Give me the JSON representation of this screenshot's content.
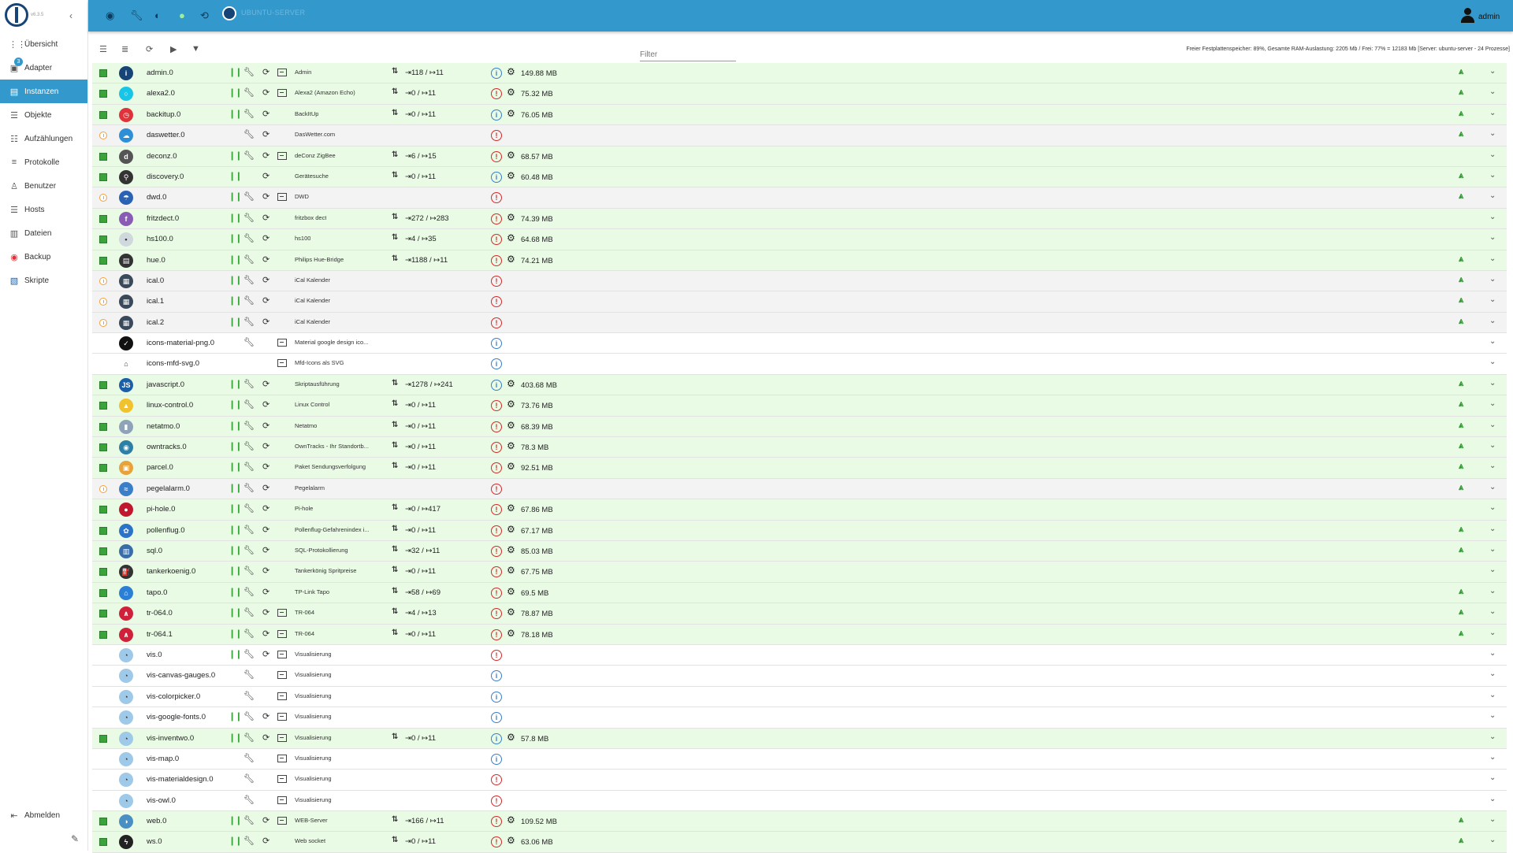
{
  "sidebar": {
    "version": "v6.3.5",
    "items": [
      {
        "label": "Übersicht",
        "icon": "grid-icon",
        "active": false
      },
      {
        "label": "Adapter",
        "icon": "adapter-icon",
        "badge": "3",
        "active": false
      },
      {
        "label": "Instanzen",
        "icon": "instances-icon",
        "active": true
      },
      {
        "label": "Objekte",
        "icon": "objects-icon",
        "active": false
      },
      {
        "label": "Aufzählungen",
        "icon": "enums-icon",
        "active": false
      },
      {
        "label": "Protokolle",
        "icon": "logs-icon",
        "active": false
      },
      {
        "label": "Benutzer",
        "icon": "user-icon",
        "active": false
      },
      {
        "label": "Hosts",
        "icon": "hosts-icon",
        "active": false
      },
      {
        "label": "Dateien",
        "icon": "files-icon",
        "active": false
      },
      {
        "label": "Backup",
        "icon": "backup-icon",
        "active": false
      },
      {
        "label": "Skripte",
        "icon": "scripts-icon",
        "active": false
      }
    ],
    "logout": "Abmelden"
  },
  "header": {
    "host": "UBUNTU-SERVER",
    "user": "admin"
  },
  "toolbar": {
    "filter_placeholder": "Filter",
    "sysinfo": "Freier Festplattenspeicher: 89%, Gesamte RAM-Auslastung: 2205 Mb / Frei: 77% = 12183 Mb [Server: ubuntu-server - 24 Prozesse]"
  },
  "colors": {
    "accent": "#3399cc",
    "running": "#e9fbe5",
    "stopped": "#f3f3f3",
    "ok_green": "#3ba33b"
  },
  "instances": [
    {
      "name": "admin.0",
      "title": "Admin",
      "status": "on",
      "icon_color": "#164477",
      "icon_text": "i",
      "pause": true,
      "wrench": true,
      "reload": true,
      "link": true,
      "events": "⇥118 / ↦11",
      "info": "blue",
      "mem": "149.88 MB",
      "signal": true
    },
    {
      "name": "alexa2.0",
      "title": "Alexa2 (Amazon Echo)",
      "status": "on",
      "icon_color": "#19c5e6",
      "icon_text": "○",
      "pause": true,
      "wrench": true,
      "reload": true,
      "link": true,
      "events": "⇥0 / ↦11",
      "info": "red",
      "mem": "75.32 MB",
      "signal": true
    },
    {
      "name": "backitup.0",
      "title": "BackItUp",
      "status": "on",
      "icon_color": "#e0323a",
      "icon_text": "◷",
      "pause": true,
      "wrench": true,
      "reload": true,
      "link": false,
      "events": "⇥0 / ↦11",
      "info": "blue",
      "mem": "76.05 MB",
      "signal": true
    },
    {
      "name": "daswetter.0",
      "title": "DasWetter.com",
      "status": "off",
      "icon_color": "#2f8fd6",
      "icon_text": "☁",
      "pause": false,
      "wrench": true,
      "reload": true,
      "link": false,
      "events": "",
      "info": "red",
      "mem": "",
      "signal": true
    },
    {
      "name": "deconz.0",
      "title": "deConz ZigBee",
      "status": "on",
      "icon_color": "#555555",
      "icon_text": "d",
      "pause": true,
      "wrench": true,
      "reload": true,
      "link": true,
      "events": "⇥6 / ↦15",
      "info": "red",
      "mem": "68.57 MB",
      "signal": false
    },
    {
      "name": "discovery.0",
      "title": "Gerätesuche",
      "status": "on",
      "icon_color": "#333333",
      "icon_text": "⚲",
      "pause": true,
      "wrench": false,
      "reload": true,
      "link": false,
      "events": "⇥0 / ↦11",
      "info": "blue",
      "mem": "60.48 MB",
      "signal": true
    },
    {
      "name": "dwd.0",
      "title": "DWD",
      "status": "off",
      "icon_color": "#2a63b3",
      "icon_text": "☂",
      "pause": true,
      "wrench": true,
      "reload": true,
      "link": true,
      "events": "",
      "info": "red",
      "mem": "",
      "signal": true
    },
    {
      "name": "fritzdect.0",
      "title": "fritzbox dect",
      "status": "on",
      "icon_color": "#8a5bb5",
      "icon_text": "f",
      "pause": true,
      "wrench": true,
      "reload": true,
      "link": false,
      "events": "⇥272 / ↦283",
      "info": "red",
      "mem": "74.39 MB",
      "signal": false
    },
    {
      "name": "hs100.0",
      "title": "hs100",
      "status": "on",
      "icon_color": "#cfd8dc",
      "icon_text": "•",
      "pause": true,
      "wrench": true,
      "reload": true,
      "link": false,
      "events": "⇥4 / ↦35",
      "info": "red",
      "mem": "64.68 MB",
      "signal": false
    },
    {
      "name": "hue.0",
      "title": "Philips Hue-Bridge",
      "status": "on",
      "icon_color": "#333333",
      "icon_text": "▤",
      "pause": true,
      "wrench": true,
      "reload": true,
      "link": false,
      "events": "⇥1188 / ↦11",
      "info": "red",
      "mem": "74.21 MB",
      "signal": true
    },
    {
      "name": "ical.0",
      "title": "iCal Kalender",
      "status": "off",
      "icon_color": "#3a4a5a",
      "icon_text": "▦",
      "pause": true,
      "wrench": true,
      "reload": true,
      "link": false,
      "events": "",
      "info": "red",
      "mem": "",
      "signal": true
    },
    {
      "name": "ical.1",
      "title": "iCal Kalender",
      "status": "off",
      "icon_color": "#3a4a5a",
      "icon_text": "▦",
      "pause": true,
      "wrench": true,
      "reload": true,
      "link": false,
      "events": "",
      "info": "red",
      "mem": "",
      "signal": true
    },
    {
      "name": "ical.2",
      "title": "iCal Kalender",
      "status": "off",
      "icon_color": "#3a4a5a",
      "icon_text": "▦",
      "pause": true,
      "wrench": true,
      "reload": true,
      "link": false,
      "events": "",
      "info": "red",
      "mem": "",
      "signal": true
    },
    {
      "name": "icons-material-png.0",
      "title": "Material google design ico...",
      "status": "dis",
      "icon_color": "#111111",
      "icon_text": "✓",
      "pause": false,
      "wrench": true,
      "reload": false,
      "link": true,
      "events": "",
      "info": "blue",
      "mem": "",
      "signal": false
    },
    {
      "name": "icons-mfd-svg.0",
      "title": "Mfd-Icons als SVG",
      "status": "dis",
      "icon_color": "#ffffff",
      "icon_text": "⌂",
      "pause": false,
      "wrench": false,
      "reload": false,
      "link": true,
      "events": "",
      "info": "blue",
      "mem": "",
      "signal": false
    },
    {
      "name": "javascript.0",
      "title": "Skriptausführung",
      "status": "on",
      "icon_color": "#1a5fa8",
      "icon_text": "JS",
      "pause": true,
      "wrench": true,
      "reload": true,
      "link": false,
      "events": "⇥1278 / ↦241",
      "info": "blue",
      "mem": "403.68 MB",
      "signal": true
    },
    {
      "name": "linux-control.0",
      "title": "Linux Control",
      "status": "on",
      "icon_color": "#f2c12e",
      "icon_text": "▲",
      "pause": true,
      "wrench": true,
      "reload": true,
      "link": false,
      "events": "⇥0 / ↦11",
      "info": "red",
      "mem": "73.76 MB",
      "signal": true
    },
    {
      "name": "netatmo.0",
      "title": "Netatmo",
      "status": "on",
      "icon_color": "#8fa3b8",
      "icon_text": "▮",
      "pause": true,
      "wrench": true,
      "reload": true,
      "link": false,
      "events": "⇥0 / ↦11",
      "info": "red",
      "mem": "68.39 MB",
      "signal": true
    },
    {
      "name": "owntracks.0",
      "title": "OwnTracks - Ihr Standortb...",
      "status": "on",
      "icon_color": "#2d7fa6",
      "icon_text": "◉",
      "pause": true,
      "wrench": true,
      "reload": true,
      "link": false,
      "events": "⇥0 / ↦11",
      "info": "red",
      "mem": "78.3 MB",
      "signal": true
    },
    {
      "name": "parcel.0",
      "title": "Paket Sendungsverfolgung",
      "status": "on",
      "icon_color": "#e8a23c",
      "icon_text": "▣",
      "pause": true,
      "wrench": true,
      "reload": true,
      "link": false,
      "events": "⇥0 / ↦11",
      "info": "red",
      "mem": "92.51 MB",
      "signal": true
    },
    {
      "name": "pegelalarm.0",
      "title": "Pegelalarm",
      "status": "off",
      "icon_color": "#3a7ec8",
      "icon_text": "≈",
      "pause": true,
      "wrench": true,
      "reload": true,
      "link": false,
      "events": "",
      "info": "red",
      "mem": "",
      "signal": true
    },
    {
      "name": "pi-hole.0",
      "title": "Pi-hole",
      "status": "on",
      "icon_color": "#c0182d",
      "icon_text": "●",
      "pause": true,
      "wrench": true,
      "reload": true,
      "link": false,
      "events": "⇥0 / ↦417",
      "info": "red",
      "mem": "67.86 MB",
      "signal": false
    },
    {
      "name": "pollenflug.0",
      "title": "Pollenflug-Gefahrenindex i...",
      "status": "on",
      "icon_color": "#2a73c9",
      "icon_text": "✿",
      "pause": true,
      "wrench": true,
      "reload": true,
      "link": false,
      "events": "⇥0 / ↦11",
      "info": "red",
      "mem": "67.17 MB",
      "signal": true
    },
    {
      "name": "sql.0",
      "title": "SQL-Protokollierung",
      "status": "on",
      "icon_color": "#3a6ea8",
      "icon_text": "▥",
      "pause": true,
      "wrench": true,
      "reload": true,
      "link": false,
      "events": "⇥32 / ↦11",
      "info": "red",
      "mem": "85.03 MB",
      "signal": true
    },
    {
      "name": "tankerkoenig.0",
      "title": "Tankerkönig Spritpreise",
      "status": "on",
      "icon_color": "#333333",
      "icon_text": "⛽",
      "pause": true,
      "wrench": true,
      "reload": true,
      "link": false,
      "events": "⇥0 / ↦11",
      "info": "red",
      "mem": "67.75 MB",
      "signal": false
    },
    {
      "name": "tapo.0",
      "title": "TP-Link Tapo",
      "status": "on",
      "icon_color": "#2b7fd4",
      "icon_text": "⌂",
      "pause": true,
      "wrench": true,
      "reload": true,
      "link": false,
      "events": "⇥58 / ↦69",
      "info": "red",
      "mem": "69.5 MB",
      "signal": true
    },
    {
      "name": "tr-064.0",
      "title": "TR-064",
      "status": "on",
      "icon_color": "#d0213a",
      "icon_text": "∧",
      "pause": true,
      "wrench": true,
      "reload": true,
      "link": true,
      "events": "⇥4 / ↦13",
      "info": "red",
      "mem": "78.87 MB",
      "signal": true
    },
    {
      "name": "tr-064.1",
      "title": "TR-064",
      "status": "on",
      "icon_color": "#d0213a",
      "icon_text": "∧",
      "pause": true,
      "wrench": true,
      "reload": true,
      "link": true,
      "events": "⇥0 / ↦11",
      "info": "red",
      "mem": "78.18 MB",
      "signal": true
    },
    {
      "name": "vis.0",
      "title": "Visualisierung",
      "status": "dis",
      "icon_color": "#9fc9e8",
      "icon_text": "◔",
      "pause": true,
      "wrench": true,
      "reload": true,
      "link": true,
      "events": "",
      "info": "red",
      "mem": "",
      "signal": false
    },
    {
      "name": "vis-canvas-gauges.0",
      "title": "Visualisierung",
      "status": "dis",
      "icon_color": "#9fc9e8",
      "icon_text": "◔",
      "pause": false,
      "wrench": true,
      "reload": false,
      "link": true,
      "events": "",
      "info": "blue",
      "mem": "",
      "signal": false
    },
    {
      "name": "vis-colorpicker.0",
      "title": "Visualisierung",
      "status": "dis",
      "icon_color": "#9fc9e8",
      "icon_text": "◔",
      "pause": false,
      "wrench": true,
      "reload": false,
      "link": true,
      "events": "",
      "info": "blue",
      "mem": "",
      "signal": false
    },
    {
      "name": "vis-google-fonts.0",
      "title": "Visualisierung",
      "status": "dis",
      "icon_color": "#9fc9e8",
      "icon_text": "◔",
      "pause": true,
      "wrench": true,
      "reload": true,
      "link": true,
      "events": "",
      "info": "blue",
      "mem": "",
      "signal": false
    },
    {
      "name": "vis-inventwo.0",
      "title": "Visualisierung",
      "status": "on",
      "icon_color": "#9fc9e8",
      "icon_text": "◔",
      "pause": true,
      "wrench": true,
      "reload": true,
      "link": true,
      "events": "⇥0 / ↦11",
      "info": "blue",
      "mem": "57.8 MB",
      "signal": false
    },
    {
      "name": "vis-map.0",
      "title": "Visualisierung",
      "status": "dis",
      "icon_color": "#9fc9e8",
      "icon_text": "◔",
      "pause": false,
      "wrench": true,
      "reload": false,
      "link": true,
      "events": "",
      "info": "blue",
      "mem": "",
      "signal": false
    },
    {
      "name": "vis-materialdesign.0",
      "title": "Visualisierung",
      "status": "dis",
      "icon_color": "#9fc9e8",
      "icon_text": "◔",
      "pause": false,
      "wrench": true,
      "reload": false,
      "link": true,
      "events": "",
      "info": "red",
      "mem": "",
      "signal": false
    },
    {
      "name": "vis-owl.0",
      "title": "Visualisierung",
      "status": "dis",
      "icon_color": "#9fc9e8",
      "icon_text": "◔",
      "pause": false,
      "wrench": true,
      "reload": false,
      "link": true,
      "events": "",
      "info": "red",
      "mem": "",
      "signal": false
    },
    {
      "name": "web.0",
      "title": "WEB-Server",
      "status": "on",
      "icon_color": "#4a8fc4",
      "icon_text": "◑",
      "pause": true,
      "wrench": true,
      "reload": true,
      "link": true,
      "events": "⇥166 / ↦11",
      "info": "red",
      "mem": "109.52 MB",
      "signal": true
    },
    {
      "name": "ws.0",
      "title": "Web socket",
      "status": "on",
      "icon_color": "#222222",
      "icon_text": "ϟ",
      "pause": true,
      "wrench": true,
      "reload": true,
      "link": false,
      "events": "⇥0 / ↦11",
      "info": "red",
      "mem": "63.06 MB",
      "signal": true
    }
  ]
}
